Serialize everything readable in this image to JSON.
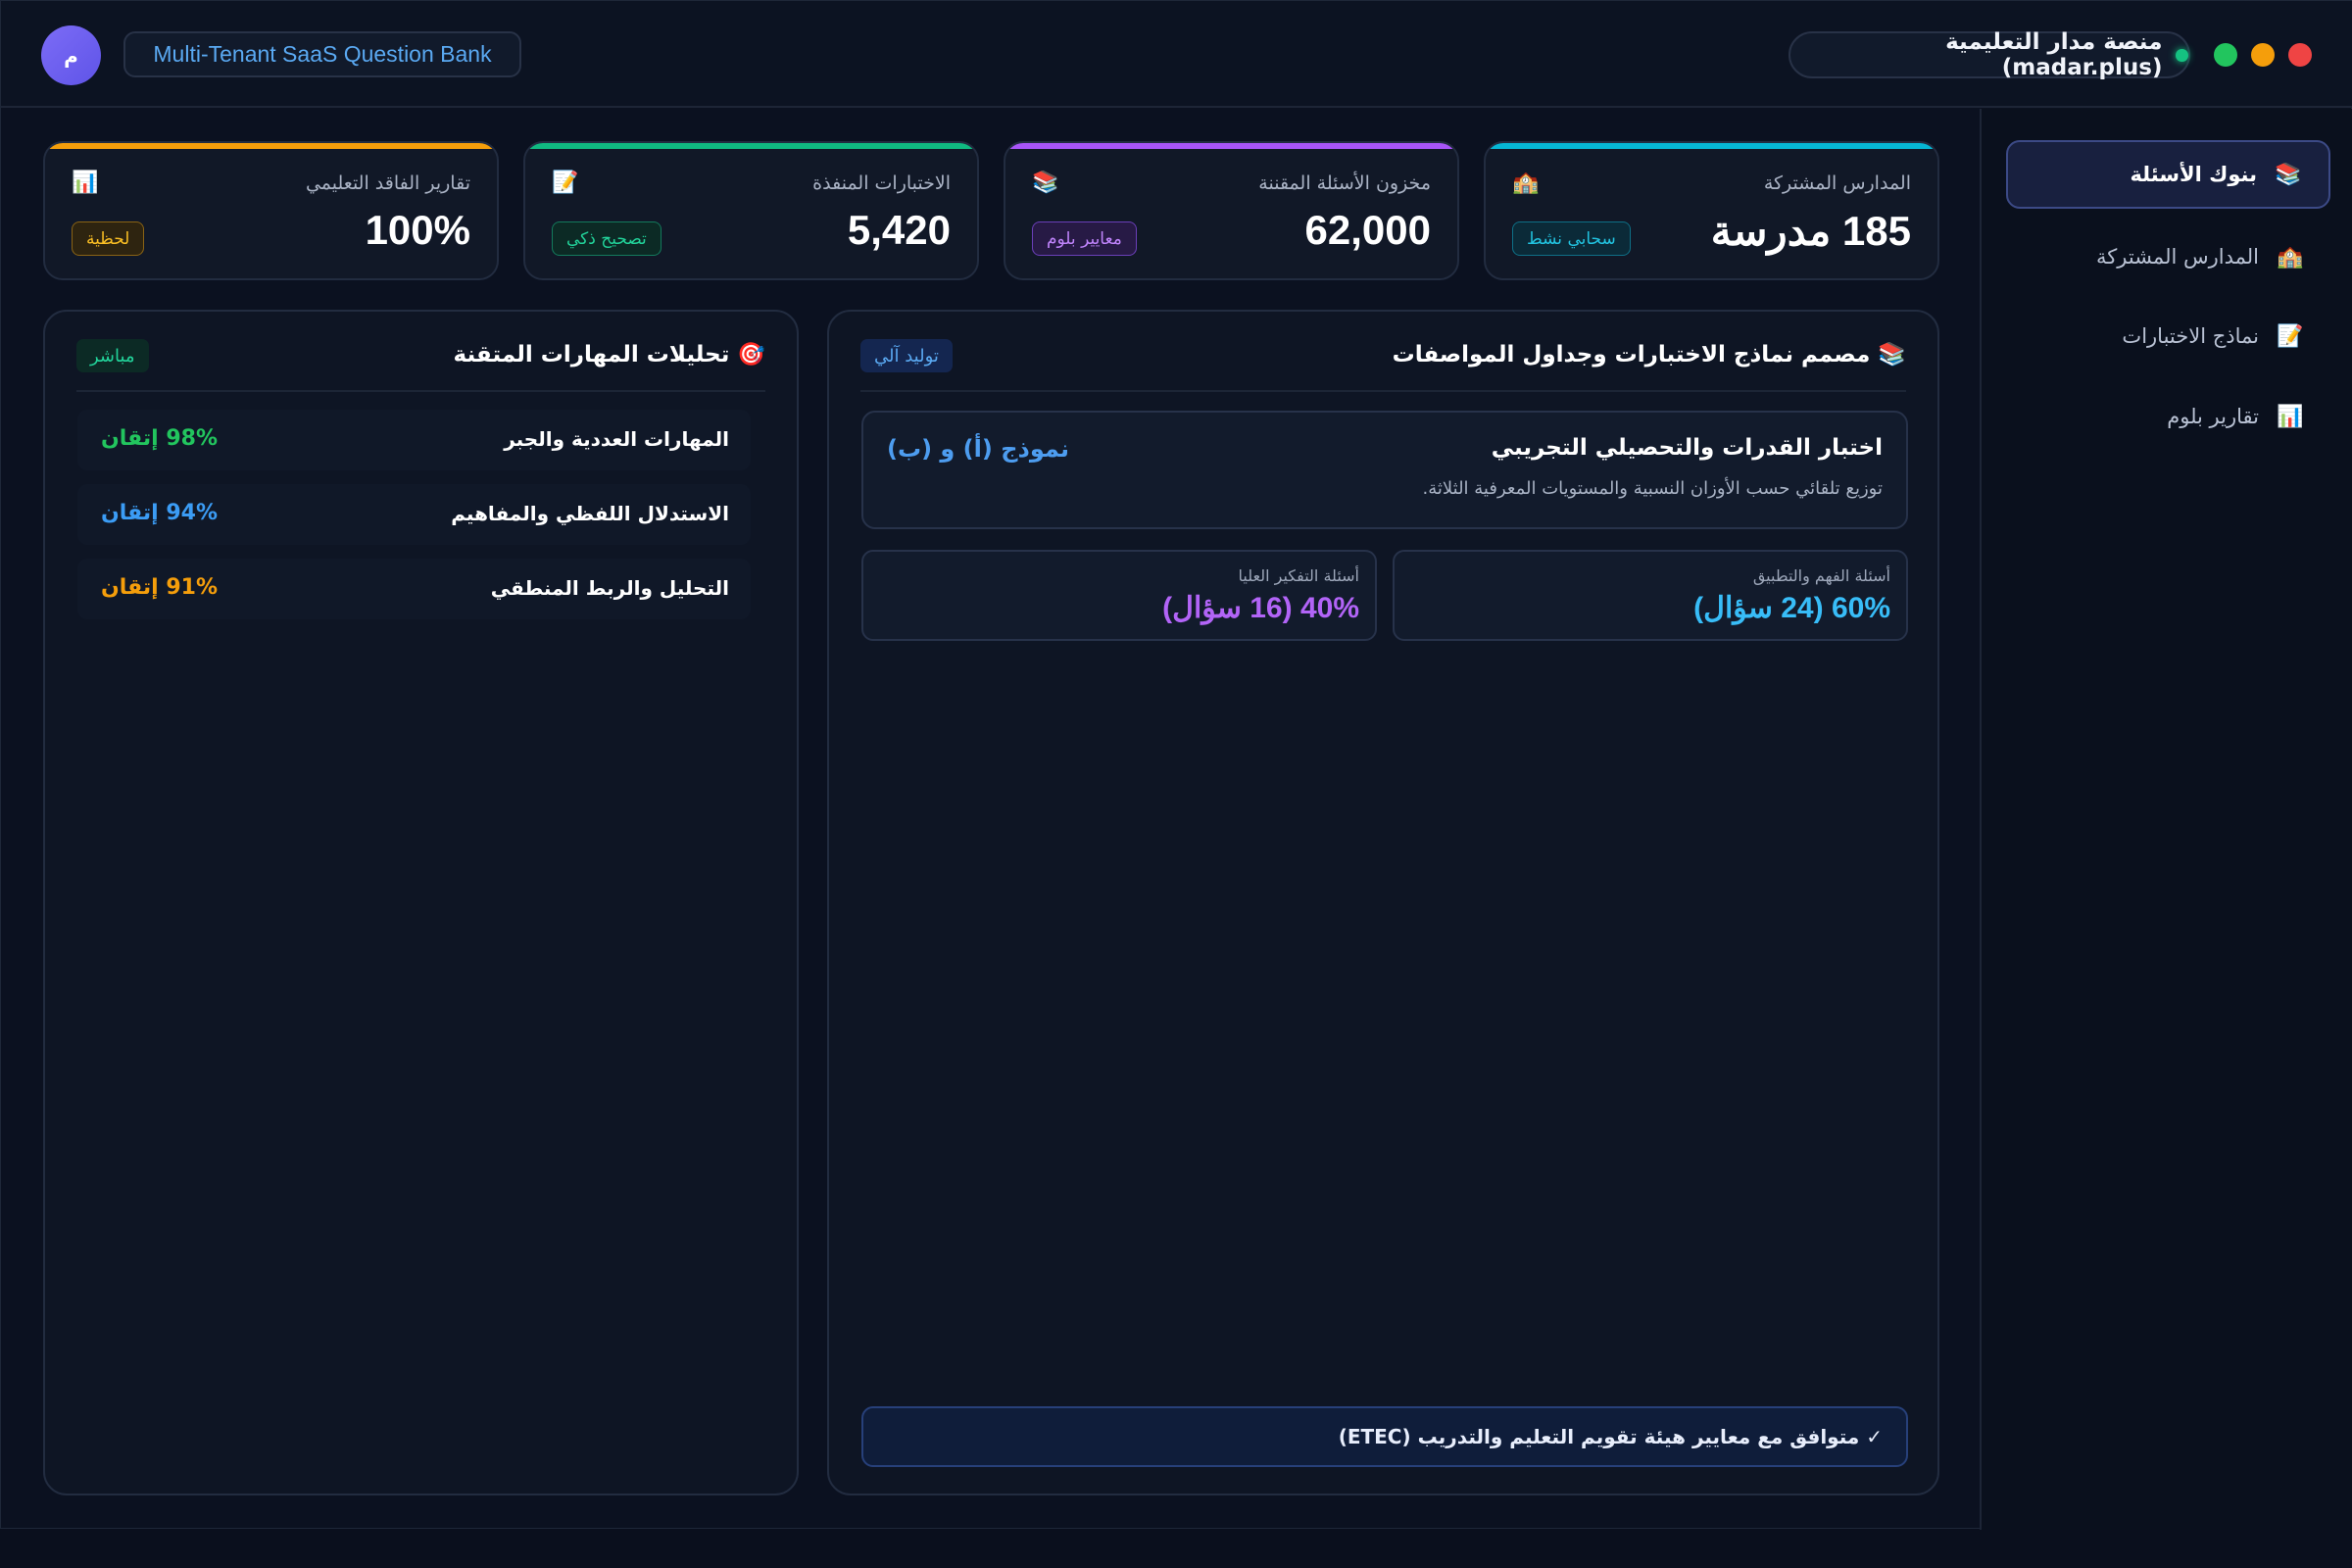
{
  "header": {
    "avatar_initial": "م",
    "app_tag": "Multi-Tenant SaaS Question Bank",
    "platform_name": "منصة مدار التعليمية (madar.plus)",
    "window_controls": {
      "green": "#22c55e",
      "yellow": "#f59e0b",
      "red": "#ef4444"
    }
  },
  "sidebar": {
    "items": [
      {
        "label": "بنوك الأسئلة",
        "icon": "📚",
        "active": true
      },
      {
        "label": "المدارس المشتركة",
        "icon": "🏫",
        "active": false
      },
      {
        "label": "نماذج الاختبارات",
        "icon": "📝",
        "active": false
      },
      {
        "label": "تقارير بلوم",
        "icon": "📊",
        "active": false
      }
    ]
  },
  "stats": [
    {
      "label": "المدارس المشتركة",
      "value": "185 مدرسة",
      "icon": "🏫",
      "badge": "سحابي نشط",
      "accent": "#06b6d4"
    },
    {
      "label": "مخزون الأسئلة المقننة",
      "value": "62,000",
      "icon": "📚",
      "badge": "معايير بلوم",
      "accent": "#a855f7"
    },
    {
      "label": "الاختبارات المنفذة",
      "value": "5,420",
      "icon": "📝",
      "badge": "تصحيح ذكي",
      "accent": "#10b981"
    },
    {
      "label": "تقارير الفاقد التعليمي",
      "value": "100%",
      "icon": "📊",
      "badge": "لحظية",
      "accent": "#f59e0b"
    }
  ],
  "designer": {
    "title": "📚 مصمم نماذج الاختبارات وجداول المواصفات",
    "badge": "توليد آلي",
    "exam": {
      "title": "اختبار القدرات والتحصيلي التجريبي",
      "description": "توزيع تلقائي حسب الأوزان النسبية والمستويات المعرفية الثلاثة.",
      "model": "نموذج (أ) و (ب)"
    },
    "distribution": [
      {
        "label": "أسئلة الفهم والتطبيق",
        "value": "60% (24 سؤال)",
        "color": "#38bdf8"
      },
      {
        "label": "أسئلة التفكير العليا",
        "value": "40% (16 سؤال)",
        "color": "#a855f7"
      }
    ],
    "compliance": "✓ متوافق مع معايير هيئة تقويم التعليم والتدريب (ETEC)"
  },
  "skills": {
    "title": "🎯 تحليلات المهارات المتقنة",
    "badge": "مباشر",
    "items": [
      {
        "name": "المهارات العددية والجبر",
        "value": "98% إتقان",
        "color": "#22c55e"
      },
      {
        "name": "الاستدلال اللفظي والمفاهيم",
        "value": "94% إتقان",
        "color": "#3b9cf5"
      },
      {
        "name": "التحليل والربط المنطقي",
        "value": "91% إتقان",
        "color": "#f59e0b"
      }
    ]
  }
}
